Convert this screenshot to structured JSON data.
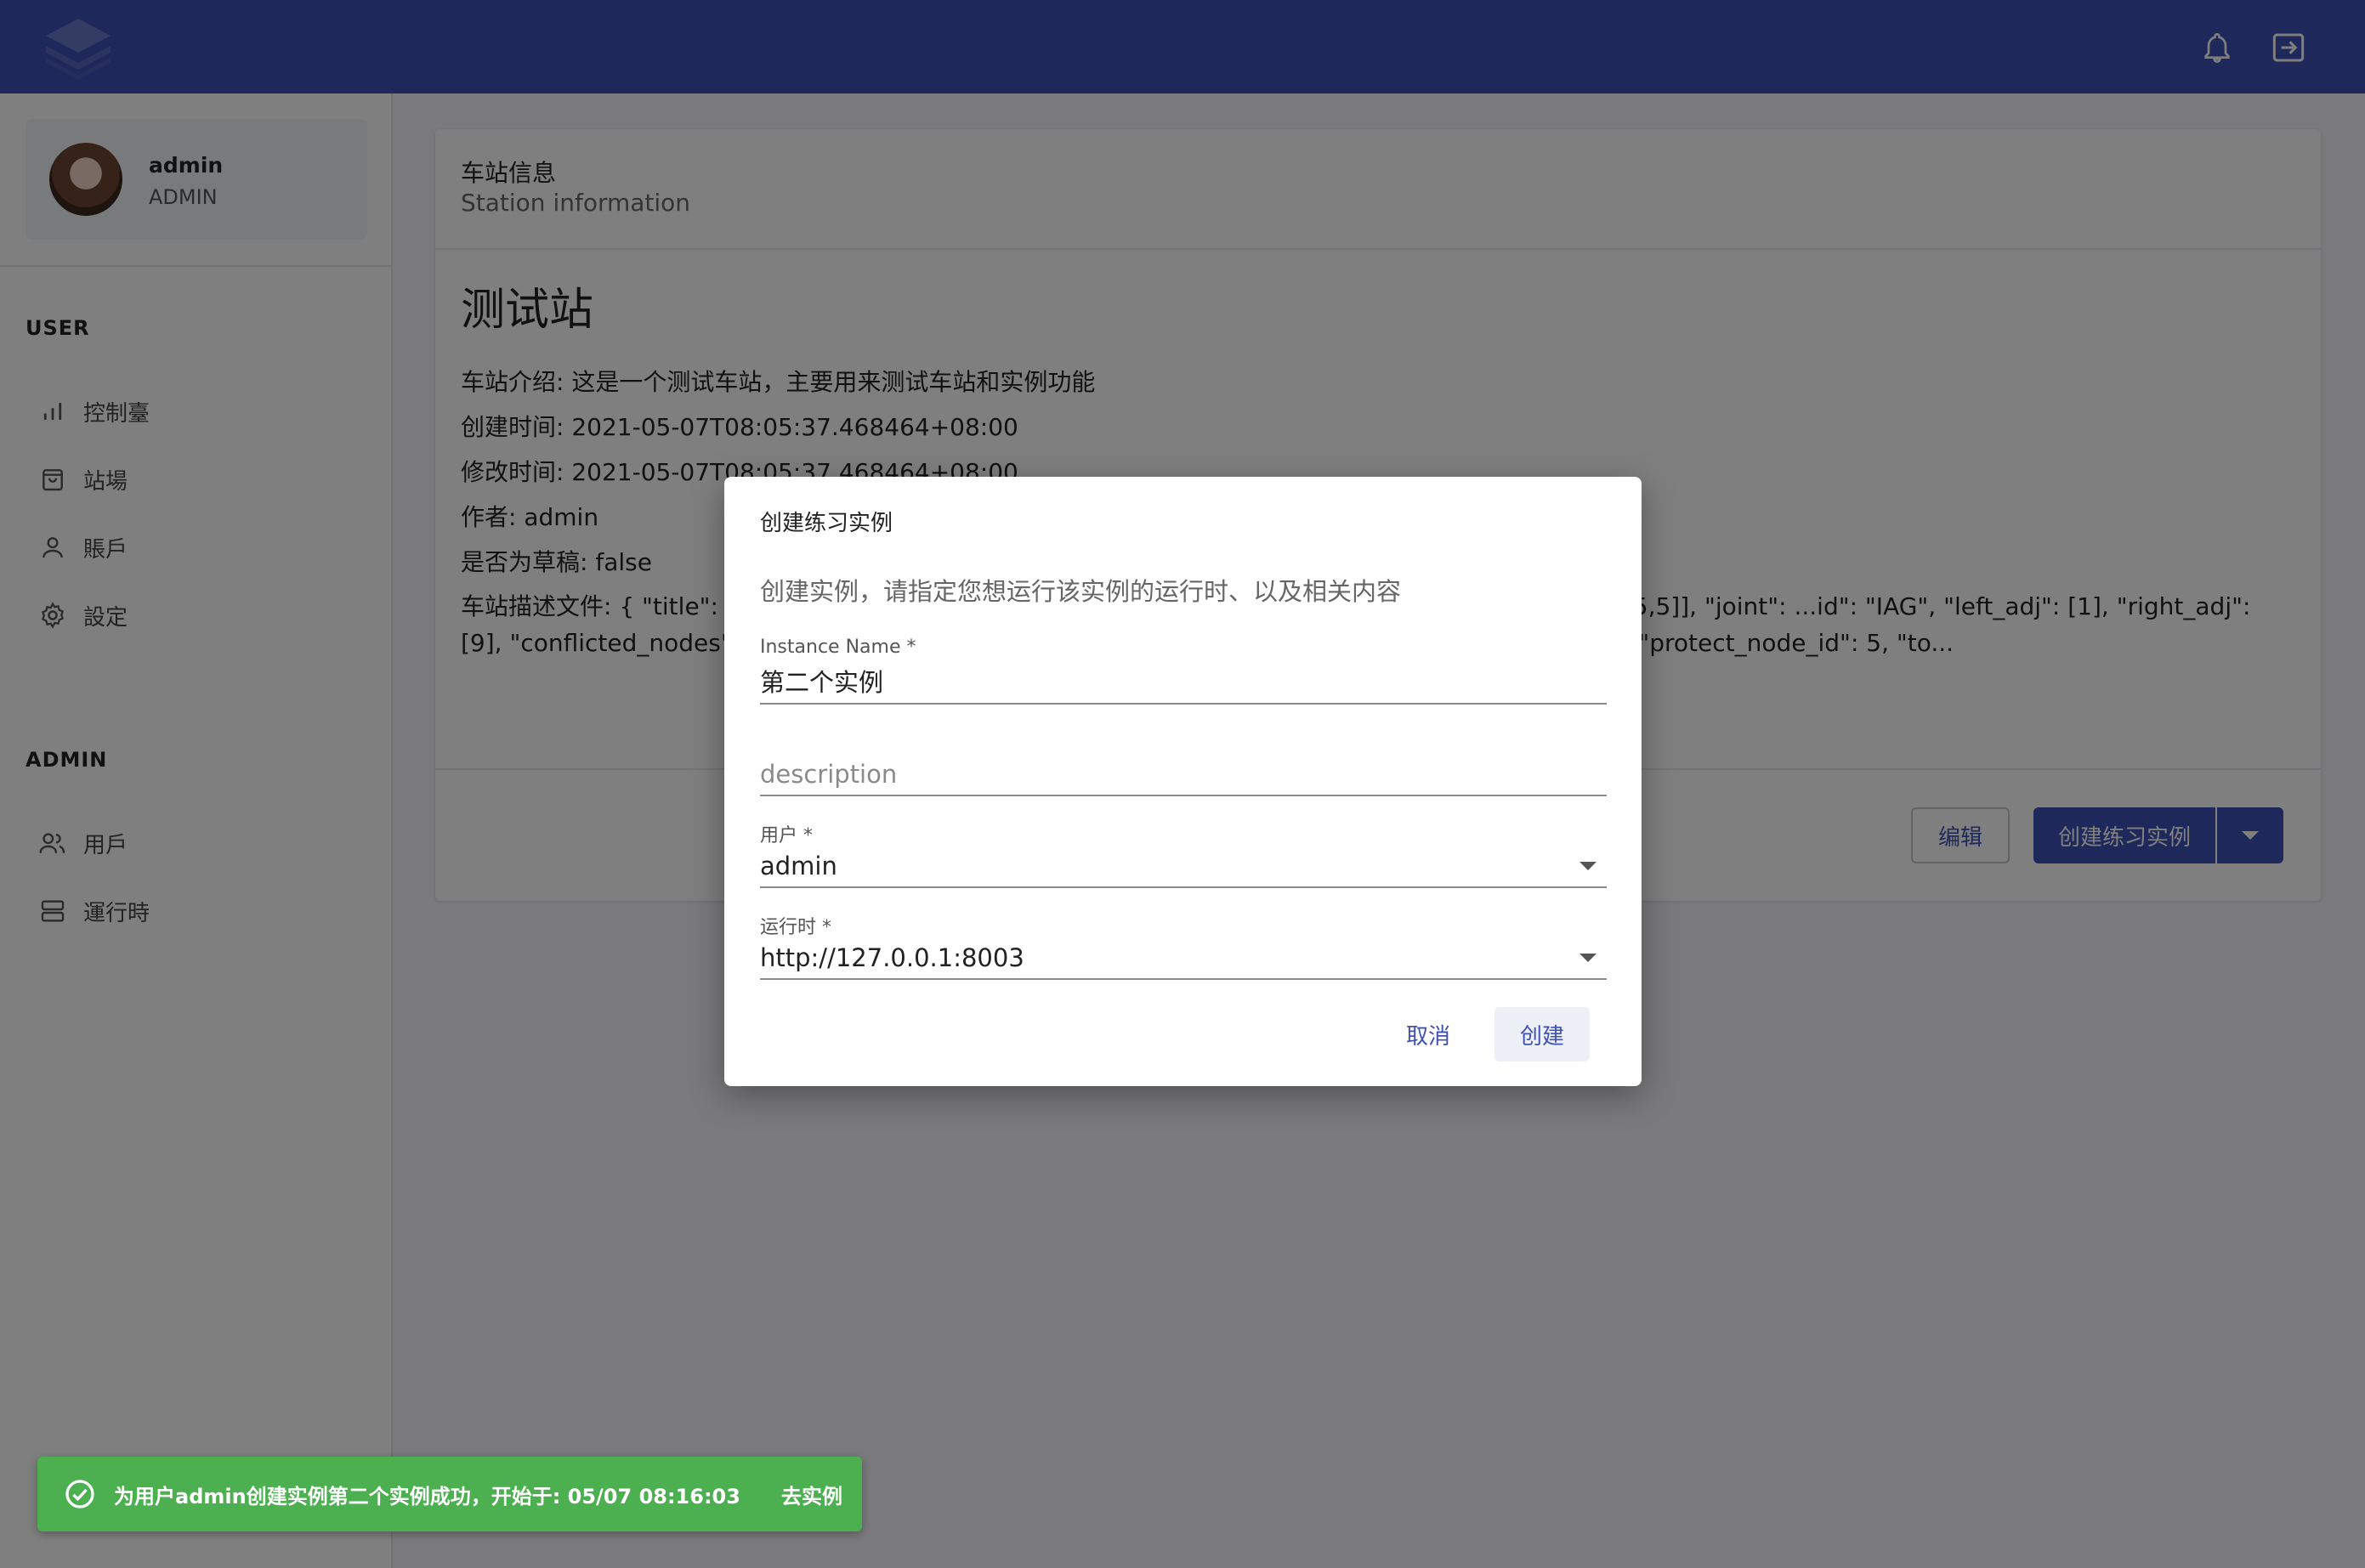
{
  "topbar": {
    "logo_icon": "layers-logo-icon",
    "notifications_icon": "bell-icon",
    "logout_icon": "logout-icon",
    "color": "#3f51b5"
  },
  "profile": {
    "name": "admin",
    "role": "ADMIN"
  },
  "sidebar": {
    "user_section": "USER",
    "user_items": [
      {
        "label": "控制臺",
        "icon": "bar-chart-icon"
      },
      {
        "label": "站場",
        "icon": "bag-icon"
      },
      {
        "label": "賬戶",
        "icon": "person-icon"
      },
      {
        "label": "設定",
        "icon": "gear-icon"
      }
    ],
    "admin_section": "ADMIN",
    "admin_items": [
      {
        "label": "用戶",
        "icon": "users-icon"
      },
      {
        "label": "運行時",
        "icon": "server-icon"
      }
    ]
  },
  "card": {
    "title": "车站信息",
    "subtitle": "Station information",
    "station_name": "测试站",
    "intro": "车站介绍: 这是一个测试车站，主要用来测试车站和实例功能",
    "created": "创建时间: 2021-05-07T08:05:37.468464+08:00",
    "modified": "修改时间: 2021-05-07T08:05:37.468464+08:00",
    "author": "作者: admin",
    "draft": "是否为草稿: false",
    "description_file": "车站描述文件: { \"title\": \"测...3JG\", \"left_adj\": [], \"right_adj\": [5], \"conflicted_nodes\": [], \"line\": [[0,5],[5,5]], \"joint\": ...id\": \"IAG\", \"left_adj\": [1], \"right_adj\": [9], \"conflicted_nodes\": [], \"line\": [[5,5],[5,10]], \"joi... ...E_SIGNAL\", \"sig_mnt\": \"POST_MOUNTING\", \"protect_node_id\": 5, \"to...",
    "edit_button": "编辑",
    "create_button": "创建练习实例",
    "dropdown_icon": "caret-down-icon"
  },
  "dialog": {
    "title": "创建练习实例",
    "text": "创建实例，请指定您想运行该实例的运行时、以及相关内容",
    "instance_name_label": "Instance Name *",
    "instance_name_value": "第二个实例",
    "description_placeholder": "description",
    "user_label": "用户 *",
    "user_value": "admin",
    "runtime_label": "运行时 *",
    "runtime_value": "http://127.0.0.1:8003",
    "cancel": "取消",
    "create": "创建"
  },
  "snackbar": {
    "message": "为用户admin创建实例第二个实例成功，开始于: 05/07 08:16:03",
    "action": "去实例",
    "icon": "check-circle-icon",
    "color": "#4caf50"
  }
}
